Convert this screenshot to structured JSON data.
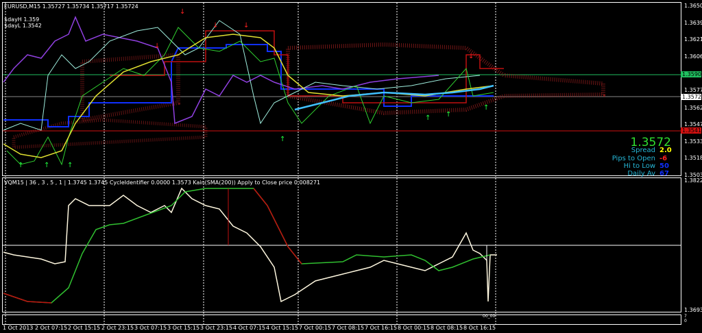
{
  "main_chart": {
    "header": "EURUSD,M15  1.35727 1.35734 1.35717 1.35724",
    "day_high": "$dayH 1.359",
    "day_low": "$dayL 1.3542",
    "price_axis": [
      "1.36500",
      "1.36395",
      "1.36210",
      "1.36060",
      "1.35770",
      "1.35620",
      "1.35475",
      "1.35330",
      "1.35180",
      "1.35030"
    ],
    "green_level": "1.35902",
    "current_price": "1.35724",
    "red_level": "1.35419"
  },
  "info_panel": {
    "price": "1.3572",
    "rows": [
      {
        "label": "Spread",
        "value": "2.0",
        "color": "#ffff00"
      },
      {
        "label": "Pips to Open",
        "value": "-6",
        "color": "#ff2020"
      },
      {
        "label": "Hi to Low",
        "value": "50",
        "color": "#1030ff"
      },
      {
        "label": "Daily Av",
        "value": "67",
        "color": "#1030ff"
      }
    ]
  },
  "indicator_panel": {
    "header": "VQM15 | 36 , 3 , 5 , 1 |  1.3745 1.3745  CycleIdentifier 0.0000 1.3573  Kain(SMA(200)) Apply to Close price 0.008271",
    "axis_top": "1.3822",
    "axis_bottom": "1.3693"
  },
  "sub_panel": {
    "label": "00_00",
    "axis_top": "7",
    "axis_bottom": "0"
  },
  "time_axis": [
    "1 Oct 2013",
    "2 Oct 07:15",
    "2 Oct 15:15",
    "2 Oct 23:15",
    "3 Oct 07:15",
    "3 Oct 15:15",
    "3 Oct 23:15",
    "4 Oct 07:15",
    "4 Oct 15:15",
    "7 Oct 00:15",
    "7 Oct 08:15",
    "7 Oct 16:15",
    "8 Oct 00:15",
    "8 Oct 08:15",
    "8 Oct 16:15"
  ]
}
